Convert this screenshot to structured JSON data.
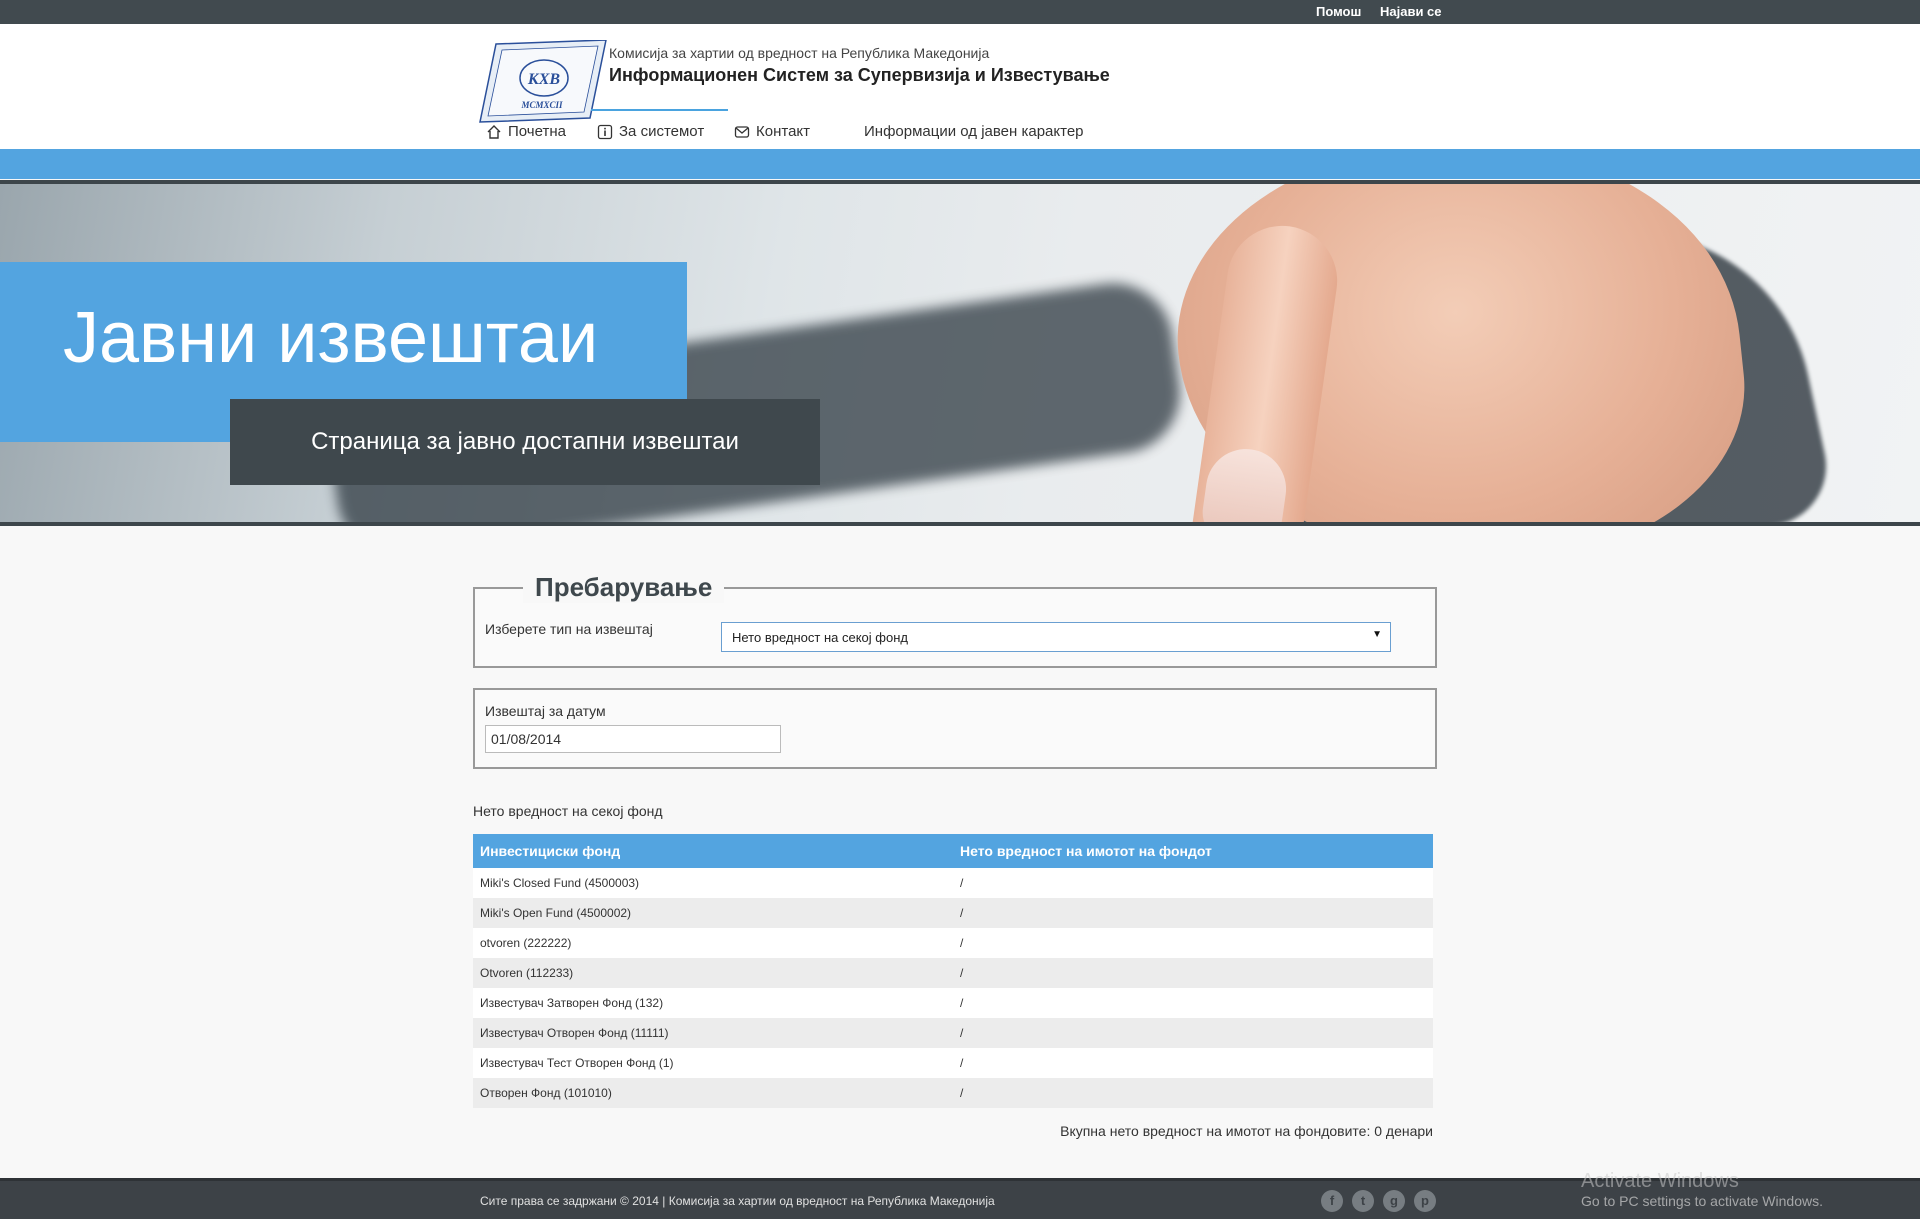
{
  "topbar": {
    "help": "Помош",
    "login": "Најави се"
  },
  "header": {
    "org_small": "Комисија за хартии од вредност на Република Македонија",
    "org_big": "Информационен Систем за Супервизија и Известување",
    "logo_text": "КХВ",
    "logo_sub": "MCMXCII"
  },
  "nav": {
    "items": [
      {
        "label": "Почетна",
        "icon": "home-icon"
      },
      {
        "label": "За системот",
        "icon": "info-icon"
      },
      {
        "label": "Контакт",
        "icon": "mail-icon"
      },
      {
        "label": "Информации од јавен карактер"
      }
    ],
    "active": "За системот"
  },
  "hero": {
    "title": "Јавни извештаи",
    "subtitle": "Страница за јавно достапни извештаи"
  },
  "search": {
    "legend": "Пребарување",
    "type_label": "Изберете тип на извештај",
    "type_selected": "Нето вредност на секој фонд",
    "date_label": "Извештај за датум",
    "date_value": "01/08/2014"
  },
  "report": {
    "title": "Нето вредност на секој фонд",
    "columns": [
      "Инвестициски фонд",
      "Нето вредност на имотот на фондот"
    ],
    "rows": [
      [
        "Miki's Closed Fund (4500003)",
        "/"
      ],
      [
        "Miki's Open Fund (4500002)",
        "/"
      ],
      [
        "otvoren (222222)",
        "/"
      ],
      [
        "Otvoren (112233)",
        "/"
      ],
      [
        "Известувач Затворен Фонд (132)",
        "/"
      ],
      [
        "Известувач Отворен Фонд (11111)",
        "/"
      ],
      [
        "Известувач Тест Отворен Фонд (1)",
        "/"
      ],
      [
        "Отворен Фонд (101010)",
        "/"
      ]
    ],
    "total": "Вкупна нето вредност на имотот на фондовите: 0 денари"
  },
  "footer": {
    "copyright": "Сите права се задржани © 2014 | Комисија за хартии од вредност на Република Македонија",
    "social": [
      "facebook-icon",
      "twitter-icon",
      "google-plus-icon",
      "pinterest-icon"
    ]
  },
  "watermark": {
    "line1": "Activate Windows",
    "line2": "Go to PC settings to activate Windows."
  },
  "colors": {
    "accent": "#53a4e0",
    "dark": "#3f484d",
    "topbar": "#414a4f"
  }
}
